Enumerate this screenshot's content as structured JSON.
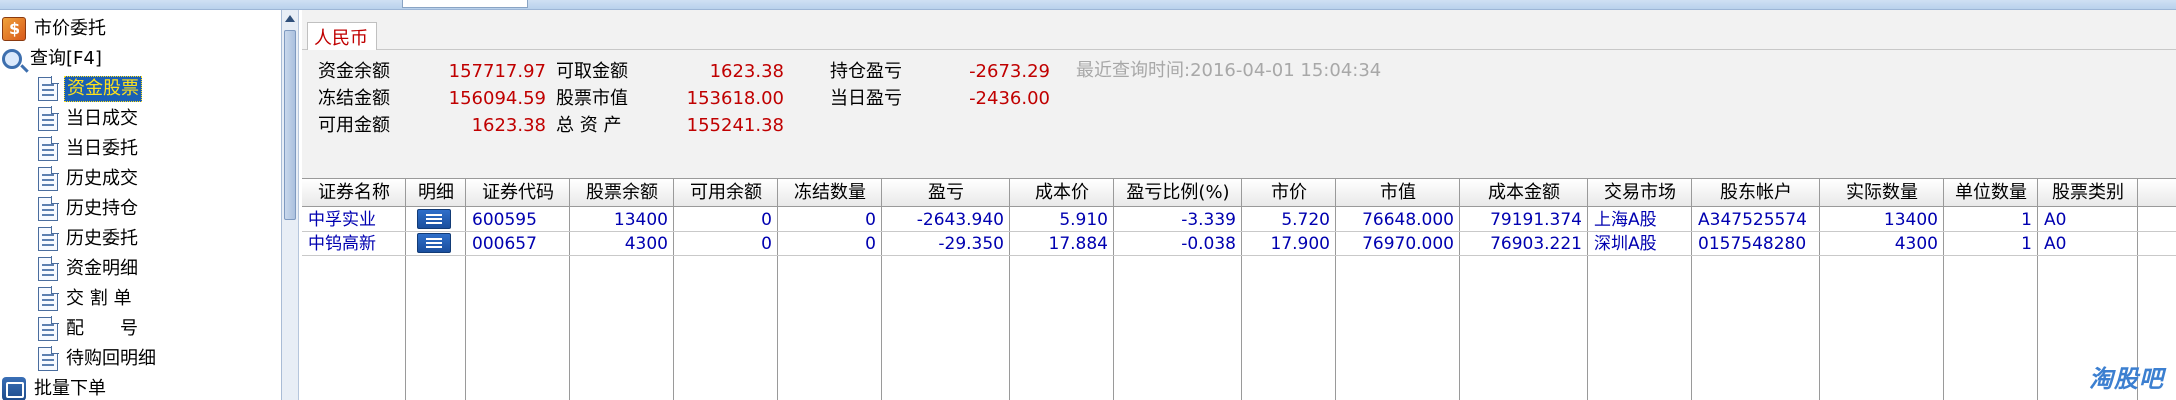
{
  "sidebar": {
    "items": [
      {
        "label": "市价委托",
        "icon": "market-order-icon",
        "level": 0
      },
      {
        "label": "查询[F4]",
        "icon": "magnifier-icon",
        "level": 0
      },
      {
        "label": "资金股票",
        "icon": "document-icon",
        "level": 1,
        "selected": true
      },
      {
        "label": "当日成交",
        "icon": "document-icon",
        "level": 1
      },
      {
        "label": "当日委托",
        "icon": "document-icon",
        "level": 1
      },
      {
        "label": "历史成交",
        "icon": "document-icon",
        "level": 1
      },
      {
        "label": "历史持仓",
        "icon": "document-icon",
        "level": 1
      },
      {
        "label": "历史委托",
        "icon": "document-icon",
        "level": 1
      },
      {
        "label": "资金明细",
        "icon": "document-icon",
        "level": 1
      },
      {
        "label": "交 割 单",
        "icon": "document-icon",
        "level": 1
      },
      {
        "label": "配　　号",
        "icon": "document-icon",
        "level": 1
      },
      {
        "label": "待购回明细",
        "icon": "document-icon",
        "level": 1
      },
      {
        "label": "批量下单",
        "icon": "batch-order-icon",
        "level": 0
      }
    ]
  },
  "tab": {
    "label": "人民币"
  },
  "summary": {
    "labels": [
      "资金余额",
      "冻结金额",
      "可用金额",
      "可取金额",
      "股票市值",
      "总 资 产",
      "持仓盈亏",
      "当日盈亏"
    ],
    "values": [
      "157717.97",
      "156094.59",
      "1623.38",
      "1623.38",
      "153618.00",
      "155241.38",
      "-2673.29",
      "-2436.00"
    ],
    "last_query": "最近查询时间:2016-04-01 15:04:34"
  },
  "table": {
    "columns": [
      "证券名称",
      "明细",
      "证券代码",
      "股票余额",
      "可用余额",
      "冻结数量",
      "盈亏",
      "成本价",
      "盈亏比例(%)",
      "市价",
      "市值",
      "成本金额",
      "交易市场",
      "股东帐户",
      "实际数量",
      "单位数量",
      "股票类别"
    ],
    "rows": [
      [
        "中孚实业",
        "",
        "600595",
        "13400",
        "0",
        "0",
        "-2643.940",
        "5.910",
        "-3.339",
        "5.720",
        "76648.000",
        "79191.374",
        "上海A股",
        "A347525574",
        "13400",
        "1",
        "A0"
      ],
      [
        "中钨高新",
        "",
        "000657",
        "4300",
        "0",
        "0",
        "-29.350",
        "17.884",
        "-0.038",
        "17.900",
        "76970.000",
        "76903.221",
        "深圳A股",
        "0157548280",
        "4300",
        "1",
        "A0"
      ]
    ]
  },
  "watermark": "淘股吧",
  "colors": {
    "accent_red": "#c00000",
    "table_text": "#0000b0",
    "selected_bg": "#1a5fb4",
    "selected_text": "#ffe11a"
  }
}
